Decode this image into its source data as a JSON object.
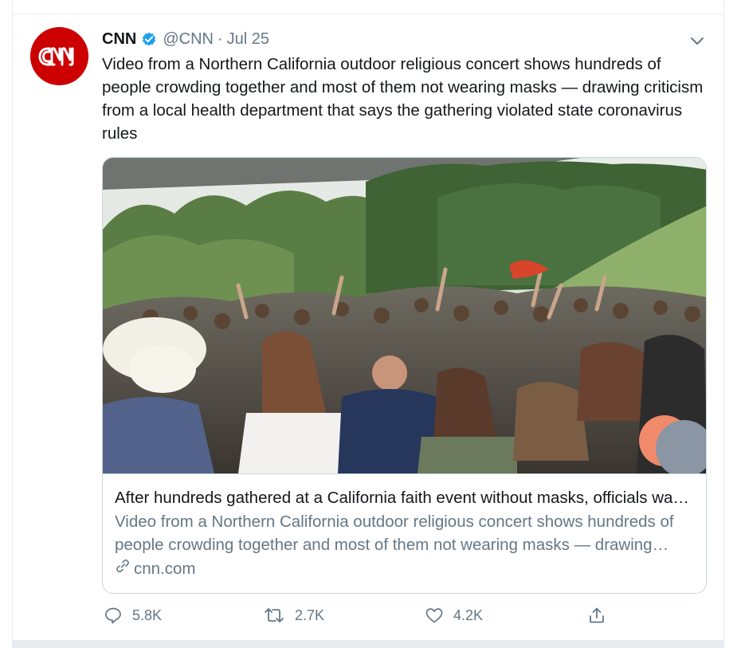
{
  "tweet": {
    "author_name": "CNN",
    "handle": "@CNN",
    "separator": "·",
    "date": "Jul 25",
    "avatar_logo_text": "CNN",
    "text": "Video from a Northern California outdoor religious concert shows hundreds of people crowding together and most of them not wearing masks — drawing criticism from a local health department that says the gathering violated state coronavirus rules"
  },
  "card": {
    "title": "After hundreds gathered at a California faith event without masks, officials warn of coronavirus risk",
    "description": "Video from a Northern California outdoor religious concert shows hundreds of people crowding together and most of them not wearing masks — drawing criticism from a local health department",
    "domain": "cnn.com"
  },
  "actions": {
    "reply_count": "5.8K",
    "retweet_count": "2.7K",
    "like_count": "4.2K"
  },
  "colors": {
    "brand_red": "#cc0000",
    "verified_blue": "#1da1f2",
    "secondary_text": "#657786",
    "primary_text": "#14171a",
    "border": "#ccd6dd"
  },
  "icons": [
    "cnn-logo",
    "verified-badge-icon",
    "chevron-down-icon",
    "link-icon",
    "reply-icon",
    "retweet-icon",
    "like-icon",
    "share-icon"
  ]
}
